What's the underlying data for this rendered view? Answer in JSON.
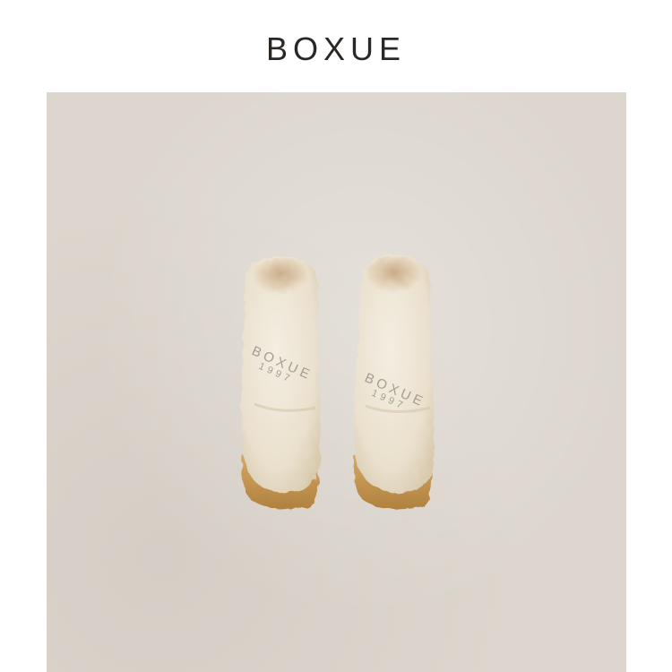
{
  "header": {
    "brand": "BOXUE"
  },
  "photo": {
    "subject": "boots",
    "watermark_brand": "BOXUE",
    "watermark_year": "1997",
    "colors": {
      "background": "#dcd6ce",
      "shearling": "#eee6d6",
      "shearling_shadow": "#d9cdb7",
      "sole": "#c79955",
      "sole_dark": "#a87a3c"
    }
  }
}
